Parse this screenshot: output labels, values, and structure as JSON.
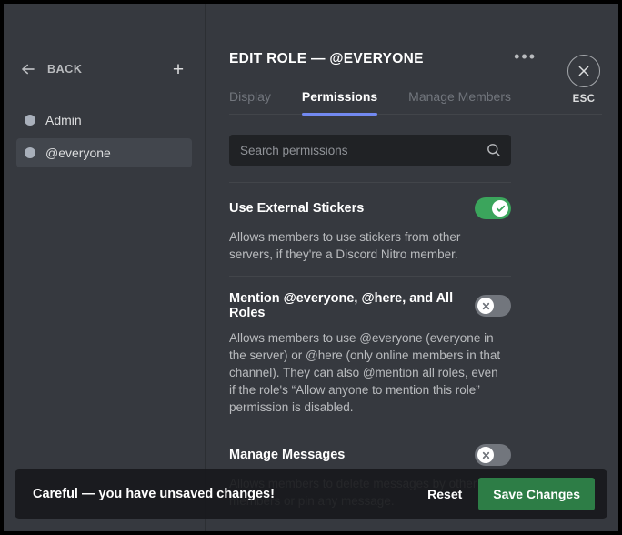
{
  "sidebar": {
    "back_label": "BACK",
    "back_icon": "arrow-left-icon",
    "add_icon": "plus-icon",
    "roles": [
      {
        "name": "Admin",
        "dot_color": "#a9b0bb",
        "selected": false
      },
      {
        "name": "@everyone",
        "dot_color": "#a9b0bb",
        "selected": true
      }
    ]
  },
  "header": {
    "title": "EDIT ROLE — @EVERYONE",
    "overflow_icon": "ellipsis-icon",
    "close": {
      "icon": "close-icon",
      "label": "ESC"
    }
  },
  "tabs": [
    {
      "label": "Display",
      "active": false
    },
    {
      "label": "Permissions",
      "active": true
    },
    {
      "label": "Manage Members",
      "active": false
    }
  ],
  "search": {
    "placeholder": "Search permissions",
    "value": "",
    "icon": "search-icon"
  },
  "permissions": [
    {
      "name": "Use External Stickers",
      "description": "Allows members to use stickers from other servers, if they're a Discord Nitro member.",
      "enabled": true
    },
    {
      "name": "Mention @everyone, @here, and All Roles",
      "description": "Allows members to use @everyone (everyone in the server) or @here (only online members in that channel). They can also @mention all roles, even if the role's “Allow anyone to mention this role” permission is disabled.",
      "enabled": false
    },
    {
      "name": "Manage Messages",
      "description": "Allows members to delete messages by other members or pin any message.",
      "enabled": false
    }
  ],
  "unsaved_bar": {
    "message": "Careful — you have unsaved changes!",
    "reset_label": "Reset",
    "save_label": "Save Changes"
  },
  "colors": {
    "accent": "#7289f0",
    "toggle_on": "#3ba55c",
    "toggle_off": "#72767d",
    "save_button": "#2d7d46",
    "background": "#36393f",
    "search_background": "#202225"
  }
}
